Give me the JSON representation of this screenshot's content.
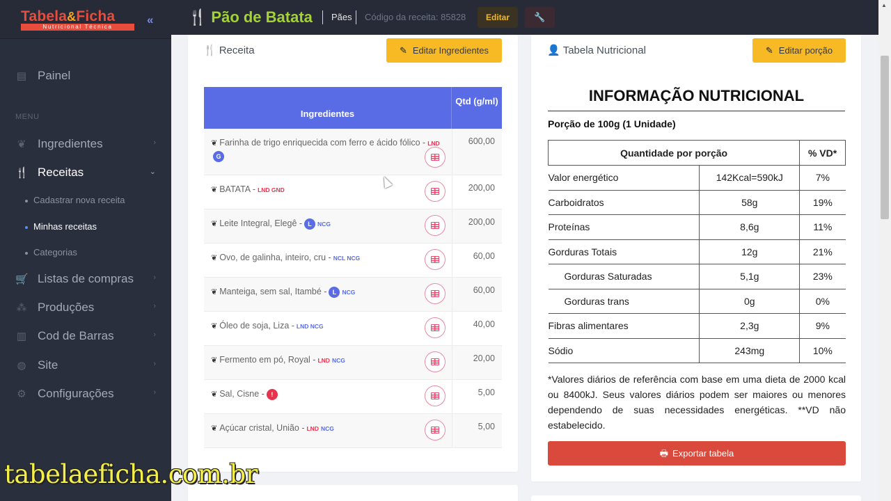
{
  "sidebar": {
    "logo_main_1": "Tabela",
    "logo_amp": "&",
    "logo_main_2": "Ficha",
    "logo_sub": "Nutricional Técnica",
    "collapse_glyph": "«",
    "menu_label": "MENU",
    "items": [
      {
        "label": "Painel",
        "icon": "dashboard-icon"
      },
      {
        "label": "Ingredientes",
        "icon": "leaf-icon"
      },
      {
        "label": "Receitas",
        "icon": "utensils-icon"
      },
      {
        "label": "Listas de compras",
        "icon": "cart-icon"
      },
      {
        "label": "Produções",
        "icon": "boxes-icon"
      },
      {
        "label": "Cod de Barras",
        "icon": "barcode-icon"
      },
      {
        "label": "Site",
        "icon": "globe-icon"
      },
      {
        "label": "Configurações",
        "icon": "users-cog-icon"
      }
    ],
    "sub_items": [
      "Cadastrar nova receita",
      "Minhas receitas",
      "Categorias"
    ]
  },
  "topbar": {
    "title": "Pão de Batata",
    "category": "Pães",
    "code": "Código da receita: 85828",
    "edit_label": "Editar"
  },
  "recipe_card": {
    "title": "Receita",
    "edit_button": "Editar Ingredientes",
    "col_ingredients": "Ingredientes",
    "col_qty": "Qtd (g/ml)",
    "rows": [
      {
        "name": "Farinha de trigo enriquecida com ferro e ácido fólico -",
        "tags_red": "LND",
        "tags_blue": "",
        "pill": "G",
        "pill_color": "blue",
        "qty": "600,00"
      },
      {
        "name": "BATATA -",
        "tags_red": "LND  GND",
        "tags_blue": "",
        "pill": "",
        "pill_color": "",
        "qty": "200,00"
      },
      {
        "name": "Leite Integral, Elegê -",
        "tags_red": "",
        "tags_blue": "NCG",
        "pill": "L",
        "pill_color": "blue",
        "qty": "200,00"
      },
      {
        "name": "Ovo, de galinha, inteiro, cru -",
        "tags_red": "",
        "tags_blue": "NCL NCG",
        "pill": "",
        "pill_color": "",
        "qty": "60,00"
      },
      {
        "name": "Manteiga, sem sal, Itambé -",
        "tags_red": "",
        "tags_blue": "NCG",
        "pill": "L",
        "pill_color": "blue",
        "qty": "60,00"
      },
      {
        "name": "Óleo de soja, Liza -",
        "tags_red": "",
        "tags_blue": "LND NCG",
        "pill": "",
        "pill_color": "",
        "qty": "40,00"
      },
      {
        "name": "Fermento em pó, Royal -",
        "tags_red": "LND",
        "tags_blue": "NCG",
        "pill": "",
        "pill_color": "",
        "qty": "20,00"
      },
      {
        "name": "Sal, Cisne -",
        "tags_red": "",
        "tags_blue": "",
        "pill": "!",
        "pill_color": "red",
        "qty": "5,00"
      },
      {
        "name": "Açúcar cristal, União -",
        "tags_red": "LND",
        "tags_blue": "NCG",
        "pill": "",
        "pill_color": "",
        "qty": "5,00"
      }
    ]
  },
  "nutrition_card": {
    "title": "Tabela Nutricional",
    "edit_button": "Editar porção",
    "heading": "INFORMAÇÃO NUTRICIONAL",
    "portion": "Porção de 100g (1 Unidade)",
    "col_qty": "Quantidade por porção",
    "col_vd": "% VD*",
    "rows": [
      {
        "label": "Valor energético",
        "value": "142Kcal=590kJ",
        "vd": "7%",
        "indent": false
      },
      {
        "label": "Carboidratos",
        "value": "58g",
        "vd": "19%",
        "indent": false
      },
      {
        "label": "Proteínas",
        "value": "8,6g",
        "vd": "11%",
        "indent": false
      },
      {
        "label": "Gorduras Totais",
        "value": "12g",
        "vd": "21%",
        "indent": false
      },
      {
        "label": "Gorduras Saturadas",
        "value": "5,1g",
        "vd": "23%",
        "indent": true
      },
      {
        "label": "Gorduras trans",
        "value": "0g",
        "vd": "0%",
        "indent": true
      },
      {
        "label": "Fibras alimentares",
        "value": "2,3g",
        "vd": "9%",
        "indent": false
      },
      {
        "label": "Sódio",
        "value": "243mg",
        "vd": "10%",
        "indent": false
      }
    ],
    "note": "*Valores diários de referência com base em uma dieta de 2000 kcal ou 8400kJ. Seus valores diários podem ser maiores ou menores dependendo de suas necessidades energéticas. **VD não estabelecido.",
    "export_button": "Exportar tabela"
  },
  "watermark": "tabelaeficha.com.br",
  "colors": {
    "sidebar_bg": "#2a2f3d",
    "accent_blue": "#5a6be6",
    "brand_green": "#a4d233",
    "warning_yellow": "#f7b924",
    "danger_red": "#d94a3d"
  }
}
